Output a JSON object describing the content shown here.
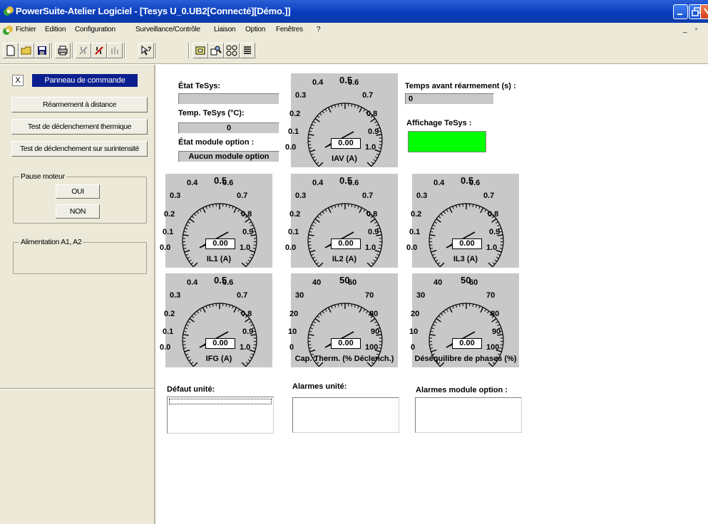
{
  "window": {
    "title": "PowerSuite-Atelier Logiciel - [Tesys U_0.UB2[Connecté][Démo.]]"
  },
  "menu": [
    "Fichier",
    "Edition",
    "Configuration",
    "Surveillance/Contrôle",
    "Liaison",
    "Option",
    "Fenêtres",
    "?"
  ],
  "toolbar": {
    "icons": [
      "new-file-icon",
      "open-folder-icon",
      "save-icon",
      "print-icon",
      "connect-icon",
      "disconnect-icon",
      "transfer-icon",
      "help-cursor-icon",
      "view-panel-icon",
      "view-zoom-icon",
      "view-dials-icon",
      "view-list-icon"
    ]
  },
  "left_panel": {
    "close_label": "X",
    "title": "Panneau de commande",
    "buttons": [
      "Réarmement à distance",
      "Test de déclenchement  thermique",
      "Test de déclenchement sur surintensité"
    ],
    "pause_group": {
      "label": "Pause moteur",
      "oui": "OUI",
      "non": "NON"
    },
    "alim_group": {
      "label": "Alimentation A1, A2"
    }
  },
  "status": {
    "etat_tesys_label": "État TeSys:",
    "etat_tesys_value": "",
    "temp_label": "Temp. TeSys (°C):",
    "temp_value": "0",
    "module_label": "État module option :",
    "module_value": "Aucun module option",
    "rearm_label": "Temps avant réarmement (s) :",
    "rearm_value": "0",
    "affichage_label": "Affichage TeSys :",
    "affichage_color": "#00ff00"
  },
  "gauges": [
    {
      "id": "iav",
      "name": "IAV (A)",
      "value": "0.00",
      "labels": [
        "0.0",
        "0.1",
        "0.2",
        "0.3",
        "0.4",
        "0.5",
        "0.6",
        "0.7",
        "0.8",
        "0.9",
        "1.0"
      ]
    },
    {
      "id": "il1",
      "name": "IL1 (A)",
      "value": "0.00",
      "labels": [
        "0.0",
        "0.1",
        "0.2",
        "0.3",
        "0.4",
        "0.5",
        "0.6",
        "0.7",
        "0.8",
        "0.9",
        "1.0"
      ]
    },
    {
      "id": "il2",
      "name": "IL2 (A)",
      "value": "0.00",
      "labels": [
        "0.0",
        "0.1",
        "0.2",
        "0.3",
        "0.4",
        "0.5",
        "0.6",
        "0.7",
        "0.8",
        "0.9",
        "1.0"
      ]
    },
    {
      "id": "il3",
      "name": "IL3 (A)",
      "value": "0.00",
      "labels": [
        "0.0",
        "0.1",
        "0.2",
        "0.3",
        "0.4",
        "0.5",
        "0.6",
        "0.7",
        "0.8",
        "0.9",
        "1.0"
      ]
    },
    {
      "id": "ifg",
      "name": "IFG (A)",
      "value": "0.00",
      "labels": [
        "0.0",
        "0.1",
        "0.2",
        "0.3",
        "0.4",
        "0.5",
        "0.6",
        "0.7",
        "0.8",
        "0.9",
        "1.0"
      ]
    },
    {
      "id": "cap",
      "name": "Cap. Therm. (% Déclench.)",
      "value": "0.00",
      "labels": [
        "0",
        "10",
        "20",
        "30",
        "40",
        "50",
        "60",
        "70",
        "80",
        "90",
        "100"
      ]
    },
    {
      "id": "deseq",
      "name": "Déséquilibre de phases (%)",
      "value": "0.00",
      "labels": [
        "0",
        "10",
        "20",
        "30",
        "40",
        "50",
        "60",
        "70",
        "80",
        "90",
        "100"
      ]
    }
  ],
  "alarms": {
    "defaut_label": "Défaut unité:",
    "alarmes_label": "Alarmes unité:",
    "module_alarm_label": "Alarmes module option :"
  }
}
